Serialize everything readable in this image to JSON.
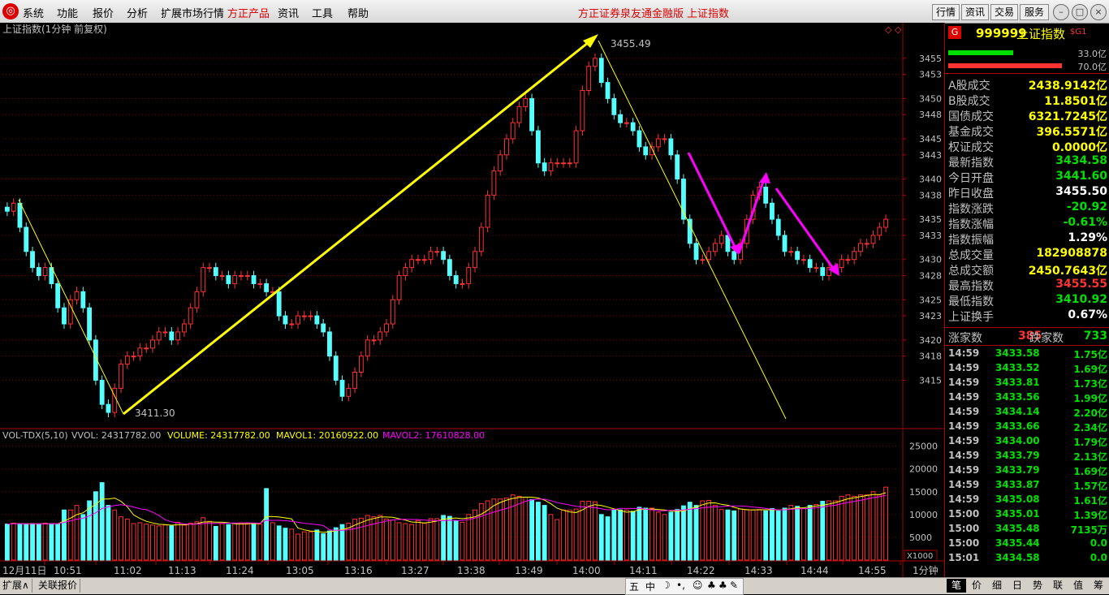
{
  "menu": {
    "items": [
      "系统",
      "功能",
      "报价",
      "分析",
      "扩展市场行情",
      "方正产品",
      "资讯",
      "工具",
      "帮助"
    ],
    "center_title": "方正证券泉友通金融版",
    "center_sub": "上证指数",
    "right_buttons": [
      "行情",
      "资讯",
      "交易",
      "服务"
    ]
  },
  "chart": {
    "title": "上证指数(1分钟 前复权)",
    "high_label": "3455.49",
    "low_label": "3411.30",
    "price_ticks": [
      "3455",
      "3453",
      "3450",
      "3448",
      "3445",
      "3443",
      "3440",
      "3438",
      "3435",
      "3433",
      "3430",
      "3428",
      "3425",
      "3423",
      "3420",
      "3418",
      "3415"
    ],
    "vol_header": {
      "name": "VOL-TDX(5,10)",
      "vvol": "VVOL: 24317782.00",
      "volume": "VOLUME: 24317782.00",
      "mavol1": "MAVOL1: 20160922.00",
      "mavol2": "MAVOL2: 17610828.00"
    },
    "vol_ticks": [
      "25000",
      "20000",
      "15000",
      "10000",
      "5000"
    ],
    "vol_unit": "X1000",
    "period": "1分钟",
    "time_labels": [
      "12月11日",
      "10:51",
      "11:02",
      "11:13",
      "11:24",
      "13:05",
      "13:16",
      "13:27",
      "13:38",
      "13:49",
      "14:00",
      "14:11",
      "14:22",
      "14:33",
      "14:44",
      "14:55"
    ],
    "colors": {
      "up": "#ff3232",
      "down": "#54ffff",
      "ma1": "#ffff00",
      "ma2": "#ff00ff",
      "grid": "#7a0000"
    }
  },
  "chart_data": {
    "type": "candlestick",
    "title": "上证指数(1分钟 前复权)",
    "ylim": [
      3410,
      3457
    ],
    "high": 3455.49,
    "low": 3411.3,
    "close": [
      3436,
      3437,
      3434,
      3431,
      3429,
      3428,
      3429,
      3427,
      3424,
      3422,
      3425,
      3426,
      3424,
      3420,
      3415,
      3412,
      3411,
      3414,
      3417,
      3418,
      3418,
      3419,
      3419,
      3420,
      3421,
      3421,
      3420,
      3421,
      3422,
      3424,
      3426,
      3429,
      3429,
      3428,
      3428,
      3427,
      3428,
      3428,
      3428,
      3427,
      3427,
      3426,
      3426,
      3423,
      3422,
      3422,
      3423,
      3423,
      3423,
      3422,
      3421,
      3418,
      3415,
      3413,
      3414,
      3416,
      3418,
      3420,
      3420,
      3421,
      3422,
      3425,
      3428,
      3429,
      3430,
      3430,
      3430,
      3431,
      3431,
      3430,
      3428,
      3427,
      3427,
      3429,
      3431,
      3434,
      3438,
      3441,
      3443,
      3445,
      3447,
      3449,
      3450,
      3446,
      3442,
      3441,
      3442,
      3442,
      3442,
      3442,
      3446,
      3451,
      3454,
      3455,
      3452,
      3450,
      3448,
      3447,
      3447,
      3446,
      3444,
      3443,
      3444,
      3445,
      3445,
      3443,
      3440,
      3435,
      3432,
      3430,
      3430,
      3431,
      3432,
      3433,
      3431,
      3430,
      3432,
      3435,
      3438,
      3439,
      3437,
      3435,
      3433,
      3431,
      3431,
      3430,
      3430,
      3429,
      3429,
      3428,
      3429,
      3429,
      3430,
      3430,
      3431,
      3432,
      3432,
      3433,
      3434,
      3435
    ],
    "volume": [
      7900,
      8100,
      8000,
      7900,
      8000,
      7900,
      8100,
      8000,
      7900,
      11000,
      11000,
      12000,
      10000,
      13000,
      15000,
      17000,
      12000,
      11000,
      9500,
      9000,
      8000,
      8200,
      7900,
      7700,
      7500,
      7700,
      7500,
      8300,
      7700,
      8100,
      8400,
      9300,
      8500,
      7400,
      8000,
      7800,
      8100,
      8200,
      7900,
      8000,
      7900,
      15700,
      8200,
      7500,
      7000,
      6800,
      5700,
      6200,
      6200,
      6600,
      5800,
      6400,
      7100,
      7800,
      8100,
      9000,
      9200,
      9800,
      9500,
      9800,
      9000,
      8800,
      8200,
      8000,
      7800,
      8700,
      8100,
      9100,
      9100,
      9800,
      9600,
      8600,
      8300,
      10000,
      11000,
      12400,
      13000,
      13400,
      13400,
      13600,
      14300,
      14000,
      13800,
      13300,
      12700,
      12000,
      10000,
      8900,
      11000,
      11000,
      11200,
      12900,
      12900,
      12800,
      10000,
      9500,
      11000,
      11000,
      11000,
      10700,
      11600,
      11400,
      11400,
      10500,
      10000,
      10500,
      11100,
      11900,
      12700,
      12000,
      13000,
      13100,
      12000,
      11100,
      11000,
      10800,
      11200,
      11100,
      11000,
      11100,
      10800,
      11300,
      10800,
      11400,
      12000,
      11800,
      11300,
      12000,
      12200,
      12900,
      13000,
      13000,
      14000,
      14300,
      14000,
      14300,
      14300,
      15000,
      14300,
      16000
    ],
    "time_labels": [
      "12月11日",
      "10:51",
      "11:02",
      "11:13",
      "11:24",
      "13:05",
      "13:16",
      "13:27",
      "13:38",
      "13:49",
      "14:00",
      "14:11",
      "14:22",
      "14:33",
      "14:44",
      "14:55"
    ]
  },
  "panel": {
    "code": "999999",
    "name": "上证指数",
    "tag": "$G1",
    "bar_green_label": "33.0亿",
    "bar_red_label": "70.0亿",
    "stats": [
      {
        "label": "A股成交",
        "value": "2438.9142亿",
        "color": "#ffff00"
      },
      {
        "label": "B股成交",
        "value": "11.8501亿",
        "color": "#ffff00"
      },
      {
        "label": "国债成交",
        "value": "6321.7245亿",
        "color": "#ffff00"
      },
      {
        "label": "基金成交",
        "value": "396.5571亿",
        "color": "#ffff00"
      },
      {
        "label": "权证成交",
        "value": "0.0000亿",
        "color": "#ffff00"
      },
      {
        "label": "最新指数",
        "value": "3434.58",
        "color": "#00e000"
      },
      {
        "label": "今日开盘",
        "value": "3441.60",
        "color": "#00e000"
      },
      {
        "label": "昨日收盘",
        "value": "3455.50",
        "color": "#ffffff"
      },
      {
        "label": "指数涨跌",
        "value": "-20.92",
        "color": "#00e000"
      },
      {
        "label": "指数涨幅",
        "value": "-0.61%",
        "color": "#00e000"
      },
      {
        "label": "指数振幅",
        "value": "1.29%",
        "color": "#ffffff"
      },
      {
        "label": "总成交量",
        "value": "182908878",
        "color": "#ffff00"
      },
      {
        "label": "总成交额",
        "value": "2450.7643亿",
        "color": "#ffff00"
      },
      {
        "label": "最高指数",
        "value": "3455.55",
        "color": "#ff3232"
      },
      {
        "label": "最低指数",
        "value": "3410.92",
        "color": "#00e000"
      },
      {
        "label": "上证换手",
        "value": "0.67%",
        "color": "#ffffff"
      }
    ],
    "up_label": "涨家数",
    "up_value": "385",
    "down_label": "跌家数",
    "down_value": "733",
    "ticks": [
      {
        "time": "14:59",
        "price": "3433.58",
        "qty": "1.75亿"
      },
      {
        "time": "14:59",
        "price": "3433.52",
        "qty": "1.69亿"
      },
      {
        "time": "14:59",
        "price": "3433.81",
        "qty": "1.73亿"
      },
      {
        "time": "14:59",
        "price": "3433.56",
        "qty": "1.99亿"
      },
      {
        "time": "14:59",
        "price": "3434.14",
        "qty": "2.20亿"
      },
      {
        "time": "14:59",
        "price": "3433.66",
        "qty": "2.34亿"
      },
      {
        "time": "14:59",
        "price": "3434.00",
        "qty": "1.79亿"
      },
      {
        "time": "14:59",
        "price": "3433.79",
        "qty": "2.13亿"
      },
      {
        "time": "14:59",
        "price": "3433.79",
        "qty": "1.69亿"
      },
      {
        "time": "14:59",
        "price": "3433.87",
        "qty": "1.57亿"
      },
      {
        "time": "14:59",
        "price": "3435.08",
        "qty": "1.61亿"
      },
      {
        "time": "15:00",
        "price": "3435.01",
        "qty": "1.39亿"
      },
      {
        "time": "15:00",
        "price": "3435.48",
        "qty": "7135万"
      },
      {
        "time": "15:00",
        "price": "3435.44",
        "qty": "0.0"
      },
      {
        "time": "15:01",
        "price": "3434.58",
        "qty": "0.0"
      }
    ],
    "tabs": [
      "笔",
      "价",
      "细",
      "日",
      "势",
      "联",
      "值",
      "筹"
    ]
  },
  "bottom": {
    "tabs": [
      "扩展∧",
      "关联报价"
    ],
    "tool_icons": [
      "五",
      "中",
      "☽",
      "•,",
      "☺",
      "♣",
      "♣",
      "✎"
    ]
  }
}
